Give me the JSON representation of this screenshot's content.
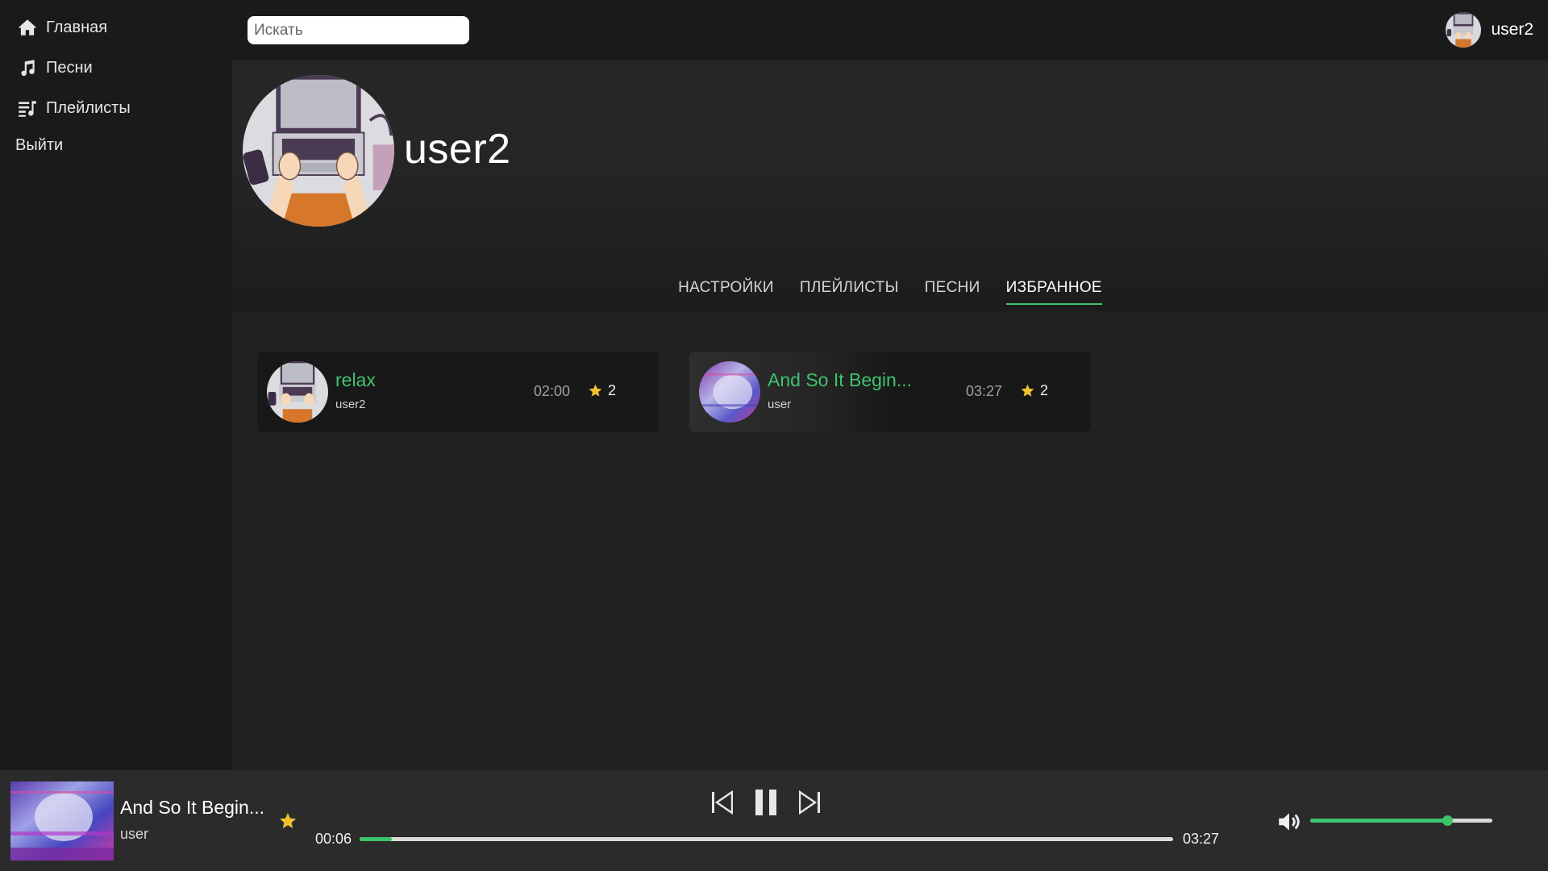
{
  "sidebar": {
    "items": [
      {
        "label": "Главная",
        "icon": "home-icon"
      },
      {
        "label": "Песни",
        "icon": "music-note-icon"
      },
      {
        "label": "Плейлисты",
        "icon": "playlist-icon"
      }
    ],
    "logout_label": "Выйти"
  },
  "header": {
    "search_placeholder": "Искать",
    "username": "user2"
  },
  "profile": {
    "name": "user2",
    "tabs": [
      {
        "label": "НАСТРОЙКИ",
        "active": false
      },
      {
        "label": "ПЛЕЙЛИСТЫ",
        "active": false
      },
      {
        "label": "ПЕСНИ",
        "active": false
      },
      {
        "label": "ИЗБРАННОЕ",
        "active": true
      }
    ]
  },
  "favorites": [
    {
      "title": "relax",
      "author": "user2",
      "duration": "02:00",
      "likes": "2"
    },
    {
      "title": "And So It Begin...",
      "author": "user",
      "duration": "03:27",
      "likes": "2"
    }
  ],
  "player": {
    "title": "And So It Begin...",
    "artist": "user",
    "current_time": "00:06",
    "total_time": "03:27",
    "progress_fraction": 0.04,
    "volume_fraction": 0.75,
    "accent_color": "#3cc46a",
    "star_color": "#f2c12e"
  }
}
